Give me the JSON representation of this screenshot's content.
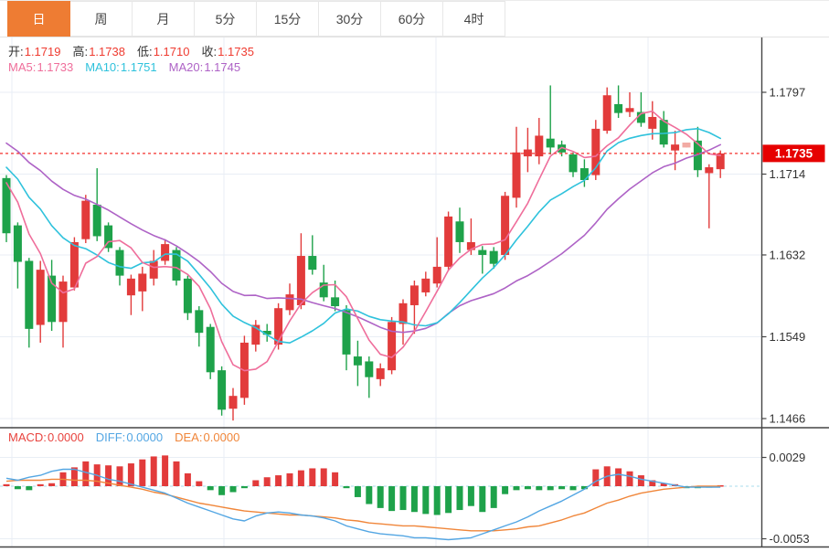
{
  "tabs": [
    {
      "label": "日",
      "selected": true
    },
    {
      "label": "周",
      "selected": false
    },
    {
      "label": "月",
      "selected": false
    },
    {
      "label": "5分",
      "selected": false
    },
    {
      "label": "15分",
      "selected": false
    },
    {
      "label": "30分",
      "selected": false
    },
    {
      "label": "60分",
      "selected": false
    },
    {
      "label": "4时",
      "selected": false
    }
  ],
  "ohlc_legend": [
    {
      "label": "开:",
      "value": "1.1719"
    },
    {
      "label": "高:",
      "value": "1.1738"
    },
    {
      "label": "低:",
      "value": "1.1710"
    },
    {
      "label": "收:",
      "value": "1.1735"
    }
  ],
  "ma_legend": [
    {
      "label": "MA5:",
      "value": "1.1733",
      "color": "#ef6e9b"
    },
    {
      "label": "MA10:",
      "value": "1.1751",
      "color": "#2fc2dc"
    },
    {
      "label": "MA20:",
      "value": "1.1745",
      "color": "#ae63c6"
    }
  ],
  "macd_legend": [
    {
      "label": "MACD:",
      "value": "0.0000",
      "color": "#e8433e"
    },
    {
      "label": "DIFF:",
      "value": "0.0000",
      "color": "#53a6e3"
    },
    {
      "label": "DEA:",
      "value": "0.0000",
      "color": "#f0863a"
    }
  ],
  "price_axis": {
    "tick_labels": [
      "1.1797",
      "1.1714",
      "1.1632",
      "1.1549",
      "1.1466"
    ],
    "tick_values": [
      1.1797,
      1.1714,
      1.1632,
      1.1549,
      1.1466
    ],
    "last_price_label": "1.1735",
    "last_price": 1.1735
  },
  "macd_axis": {
    "tick_labels": [
      "0.0029",
      "-0.0053"
    ],
    "tick_values": [
      0.0029,
      -0.0053
    ]
  },
  "colors": {
    "up": "#e23b3b",
    "down": "#1ea24a",
    "up_faded": "#f2aba4",
    "ma5": "#ef6e9b",
    "ma10": "#2fc2dc",
    "ma20": "#ae63c6",
    "diff_line": "#53a6e3",
    "dea_line": "#f0863a",
    "tab_accent": "#ee7c33",
    "badge_bg": "#e60000",
    "price_line": "#f4302e",
    "zero_line": "#a9dcec",
    "grid": "#e9eef5",
    "frame": "#454545",
    "axis_text": "#333333",
    "ohlc_value": "#ef3b30"
  },
  "chart_data": {
    "type": "candlestick",
    "title": "",
    "xlabel": "",
    "ylabel": "price",
    "price_range": [
      1.1466,
      1.1797
    ],
    "ma_periods": [
      5,
      10,
      20
    ],
    "indicator": "MACD",
    "candles_format": [
      "open",
      "high",
      "low",
      "close"
    ],
    "candles": [
      [
        1.171,
        1.1713,
        1.1645,
        1.1654
      ],
      [
        1.1662,
        1.1665,
        1.1598,
        1.1625
      ],
      [
        1.1626,
        1.1629,
        1.1538,
        1.1557
      ],
      [
        1.1561,
        1.1626,
        1.1543,
        1.1617
      ],
      [
        1.1611,
        1.1627,
        1.1555,
        1.1564
      ],
      [
        1.1564,
        1.1611,
        1.1538,
        1.1605
      ],
      [
        1.1599,
        1.165,
        1.1596,
        1.1645
      ],
      [
        1.1648,
        1.1693,
        1.1644,
        1.1687
      ],
      [
        1.1683,
        1.172,
        1.1646,
        1.1651
      ],
      [
        1.1662,
        1.1665,
        1.1635,
        1.1639
      ],
      [
        1.1637,
        1.164,
        1.1601,
        1.1611
      ],
      [
        1.1591,
        1.1612,
        1.1571,
        1.1608
      ],
      [
        1.1595,
        1.162,
        1.1575,
        1.1613
      ],
      [
        1.1608,
        1.1637,
        1.1601,
        1.1626
      ],
      [
        1.1626,
        1.1648,
        1.1622,
        1.1643
      ],
      [
        1.1637,
        1.164,
        1.1601,
        1.1606
      ],
      [
        1.1608,
        1.1611,
        1.1566,
        1.1573
      ],
      [
        1.1576,
        1.158,
        1.1539,
        1.1553
      ],
      [
        1.1559,
        1.1562,
        1.1506,
        1.1513
      ],
      [
        1.1515,
        1.1519,
        1.1469,
        1.1475
      ],
      [
        1.1476,
        1.1497,
        1.1464,
        1.1489
      ],
      [
        1.1487,
        1.155,
        1.148,
        1.1543
      ],
      [
        1.1541,
        1.1566,
        1.1534,
        1.1561
      ],
      [
        1.1555,
        1.1562,
        1.1544,
        1.1551
      ],
      [
        1.1541,
        1.1583,
        1.1536,
        1.1578
      ],
      [
        1.1576,
        1.1603,
        1.1571,
        1.1592
      ],
      [
        1.1581,
        1.1654,
        1.1577,
        1.1631
      ],
      [
        1.1631,
        1.1652,
        1.1612,
        1.1617
      ],
      [
        1.1604,
        1.1622,
        1.1585,
        1.1589
      ],
      [
        1.1589,
        1.1606,
        1.1575,
        1.158
      ],
      [
        1.1576,
        1.1581,
        1.1515,
        1.1531
      ],
      [
        1.1529,
        1.1545,
        1.1499,
        1.152
      ],
      [
        1.1524,
        1.1529,
        1.1487,
        1.1508
      ],
      [
        1.1506,
        1.1522,
        1.1499,
        1.1517
      ],
      [
        1.1515,
        1.1569,
        1.1511,
        1.1564
      ],
      [
        1.1562,
        1.1587,
        1.1541,
        1.1583
      ],
      [
        1.1581,
        1.1606,
        1.1552,
        1.1601
      ],
      [
        1.1594,
        1.1615,
        1.159,
        1.1608
      ],
      [
        1.1603,
        1.165,
        1.1599,
        1.162
      ],
      [
        1.162,
        1.1676,
        1.1616,
        1.1671
      ],
      [
        1.1666,
        1.168,
        1.1634,
        1.1645
      ],
      [
        1.1637,
        1.1669,
        1.1632,
        1.1645
      ],
      [
        1.1637,
        1.1641,
        1.1613,
        1.1632
      ],
      [
        1.1636,
        1.164,
        1.1618,
        1.1623
      ],
      [
        1.1632,
        1.1696,
        1.1627,
        1.1692
      ],
      [
        1.169,
        1.1762,
        1.168,
        1.1736
      ],
      [
        1.1732,
        1.1761,
        1.1716,
        1.1739
      ],
      [
        1.1732,
        1.1771,
        1.1724,
        1.1753
      ],
      [
        1.175,
        1.1804,
        1.1734,
        1.1741
      ],
      [
        1.1744,
        1.1748,
        1.1732,
        1.1736
      ],
      [
        1.1734,
        1.1736,
        1.1711,
        1.1716
      ],
      [
        1.172,
        1.1729,
        1.1701,
        1.1708
      ],
      [
        1.1713,
        1.1769,
        1.1708,
        1.176
      ],
      [
        1.1758,
        1.1802,
        1.1755,
        1.1794
      ],
      [
        1.1785,
        1.1804,
        1.1771,
        1.1776
      ],
      [
        1.1777,
        1.1797,
        1.1772,
        1.1781
      ],
      [
        1.1777,
        1.1797,
        1.1762,
        1.1766
      ],
      [
        1.176,
        1.1788,
        1.1749,
        1.1772
      ],
      [
        1.1769,
        1.1778,
        1.1741,
        1.1744
      ],
      [
        1.1738,
        1.1758,
        1.1718,
        1.1744
      ],
      [
        1.1741,
        1.1746,
        1.1741,
        1.1746
      ],
      [
        1.1748,
        1.1762,
        1.1711,
        1.1718
      ],
      [
        1.1715,
        1.1724,
        1.1659,
        1.1721
      ],
      [
        1.1719,
        1.1738,
        1.171,
        1.1735
      ]
    ],
    "faded_indices": [
      60
    ],
    "seed_history_closes": [
      1.179,
      1.1786,
      1.1781,
      1.1777,
      1.1772,
      1.1768,
      1.1763,
      1.1759,
      1.1754,
      1.175,
      1.1745,
      1.1741,
      1.1737,
      1.1732,
      1.1728,
      1.1723,
      1.1719,
      1.1716,
      1.1714
    ],
    "macd": {
      "hist": [
        0.0002,
        -0.0003,
        -0.0004,
        0.0002,
        0.0003,
        0.0014,
        0.0019,
        0.0025,
        0.0022,
        0.0021,
        0.002,
        0.0023,
        0.0027,
        0.003,
        0.0031,
        0.0025,
        0.0013,
        0.0005,
        -0.0004,
        -0.0009,
        -0.0006,
        -0.0002,
        0.0006,
        0.0009,
        0.0011,
        0.0013,
        0.0016,
        0.0018,
        0.0018,
        0.0014,
        -0.0002,
        -0.0011,
        -0.0018,
        -0.0022,
        -0.0025,
        -0.0024,
        -0.0026,
        -0.0028,
        -0.0029,
        -0.0027,
        -0.0024,
        -0.002,
        -0.0026,
        -0.0022,
        -0.0008,
        -0.0004,
        -0.0003,
        -0.0004,
        -0.0004,
        -0.0003,
        -0.0004,
        -0.0003,
        0.0017,
        0.002,
        0.0018,
        0.0015,
        0.0011,
        0.0006,
        0.0003,
        0.0002,
        -0.0002,
        -0.0002,
        -0.0001,
        0.0001
      ],
      "diff": [
        0.0008,
        0.0006,
        0.0009,
        0.0011,
        0.0015,
        0.0017,
        0.0017,
        0.0014,
        0.0011,
        0.0007,
        0.0005,
        0.0002,
        -0.0001,
        -0.0004,
        -0.0007,
        -0.0012,
        -0.0017,
        -0.0021,
        -0.0025,
        -0.0029,
        -0.0033,
        -0.0035,
        -0.003,
        -0.0027,
        -0.0026,
        -0.0027,
        -0.0029,
        -0.003,
        -0.0032,
        -0.0035,
        -0.004,
        -0.0043,
        -0.0046,
        -0.0048,
        -0.0049,
        -0.005,
        -0.0052,
        -0.0052,
        -0.0053,
        -0.0054,
        -0.0053,
        -0.0052,
        -0.0048,
        -0.0044,
        -0.004,
        -0.0036,
        -0.0031,
        -0.0025,
        -0.002,
        -0.0015,
        -0.0009,
        -0.0003,
        0.0005,
        0.001,
        0.0012,
        0.001,
        0.0007,
        0.0005,
        0.0003,
        0.0001,
        -0.0001,
        -0.0001,
        -0.0001,
        -0.0001
      ],
      "dea": [
        0.0005,
        0.0006,
        0.0006,
        0.0006,
        0.0007,
        0.0007,
        0.0006,
        0.0006,
        0.0005,
        0.0003,
        0.0001,
        -0.0001,
        -0.0003,
        -0.0006,
        -0.0008,
        -0.0011,
        -0.0014,
        -0.0017,
        -0.0019,
        -0.0021,
        -0.0023,
        -0.0025,
        -0.0026,
        -0.0027,
        -0.0028,
        -0.0029,
        -0.0029,
        -0.003,
        -0.0031,
        -0.0032,
        -0.0034,
        -0.0035,
        -0.0037,
        -0.0038,
        -0.0039,
        -0.004,
        -0.004,
        -0.0041,
        -0.0042,
        -0.0043,
        -0.0044,
        -0.0045,
        -0.0045,
        -0.0045,
        -0.0044,
        -0.0043,
        -0.0041,
        -0.004,
        -0.0037,
        -0.0034,
        -0.003,
        -0.0027,
        -0.0022,
        -0.0017,
        -0.0014,
        -0.001,
        -0.0007,
        -0.0005,
        -0.0003,
        -0.0002,
        -0.0001,
        0.0,
        0.0,
        0.0
      ]
    }
  }
}
